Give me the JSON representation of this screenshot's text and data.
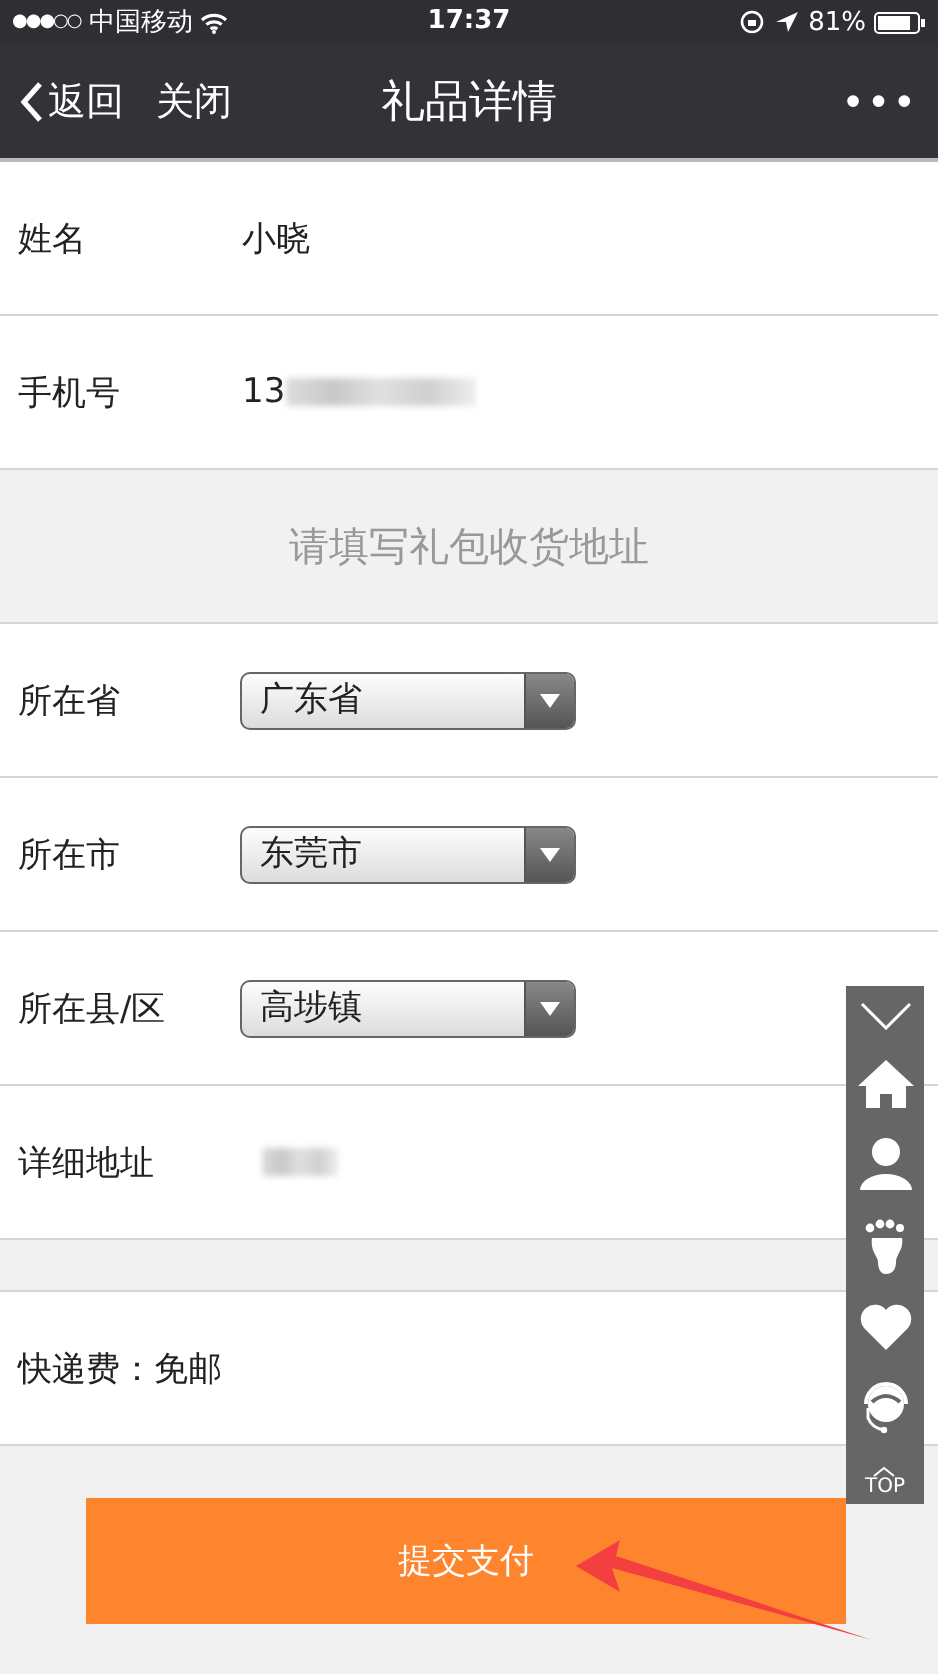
{
  "status_bar": {
    "signal": "●●●○○",
    "carrier": "中国移动",
    "time": "17:37",
    "battery": "81%"
  },
  "nav": {
    "back": "返回",
    "close": "关闭",
    "title": "礼品详情",
    "more": "•••"
  },
  "contact": [
    {
      "label": "姓名",
      "value": "小晓",
      "redacted": false
    },
    {
      "label": "手机号",
      "value": "13",
      "redacted": true
    }
  ],
  "section_hint": "请填写礼包收货地址",
  "address": [
    {
      "label": "所在省",
      "kind": "select",
      "value": "广东省"
    },
    {
      "label": "所在市",
      "kind": "select",
      "value": "东莞市"
    },
    {
      "label": "所在县/区",
      "kind": "select",
      "value": "高埗镇"
    },
    {
      "label": "详细地址",
      "kind": "text",
      "redacted": true
    }
  ],
  "shipping": "快递费：免邮",
  "submit": "提交支付",
  "side_toolbar": {
    "top_label": "TOP"
  }
}
